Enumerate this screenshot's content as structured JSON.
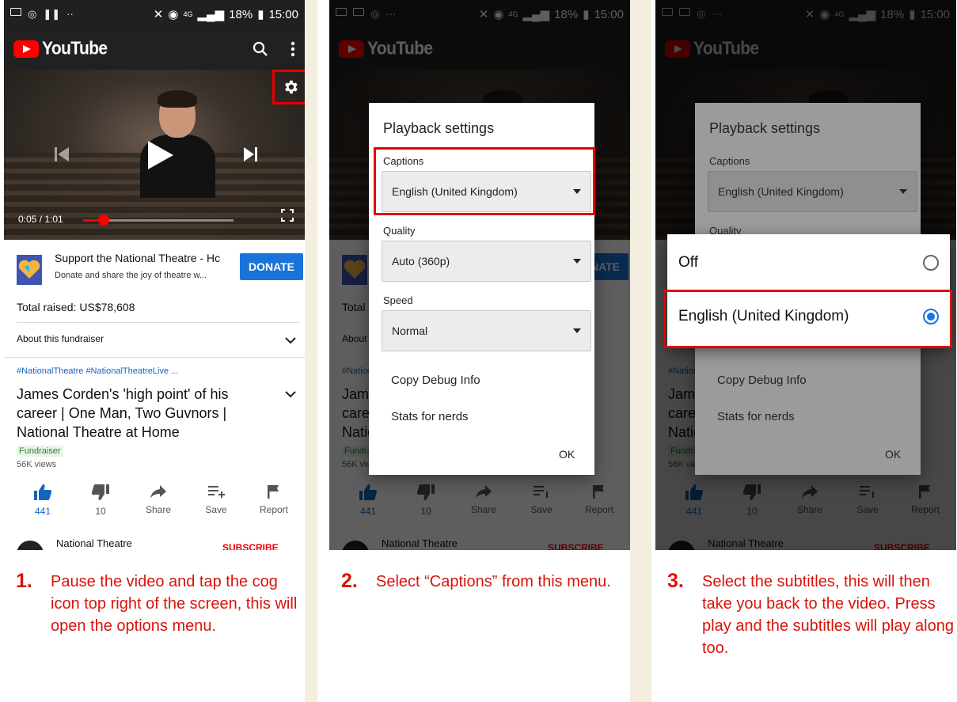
{
  "status_time": "15:00",
  "status_battery": "18%",
  "status_network": "4G",
  "brand": "YouTube",
  "video": {
    "time": "0:05 / 1:01",
    "progress": 0.08
  },
  "fundraiser": {
    "title": "Support the National Theatre - Hc",
    "subtitle": "Donate and share the joy of theatre w...",
    "donate_label": "DONATE",
    "total_raised": "Total raised: US$78,608",
    "about": "About this fundraiser"
  },
  "video_info": {
    "hashtags": "#NationalTheatre  #NationalTheatreLive ...",
    "title": "James Corden's 'high point' of his career | One Man, Two Guvnors | National Theatre at Home",
    "tag": "Fundraiser",
    "views": "56K views"
  },
  "actions": [
    {
      "label": "441",
      "icon": "thumbs-up-icon"
    },
    {
      "label": "10",
      "icon": "thumbs-down-icon"
    },
    {
      "label": "Share",
      "icon": "share-icon"
    },
    {
      "label": "Save",
      "icon": "save-icon"
    },
    {
      "label": "Report",
      "icon": "flag-icon"
    }
  ],
  "channel": {
    "name": "National Theatre",
    "subscribe": "SUBSCRIBE"
  },
  "dialog": {
    "title": "Playback settings",
    "captions_label": "Captions",
    "captions_value": "English (United Kingdom)",
    "quality_label": "Quality",
    "quality_value": "Auto (360p)",
    "speed_label": "Speed",
    "speed_value": "Normal",
    "copy_debug": "Copy Debug Info",
    "stats": "Stats for nerds",
    "ok": "OK"
  },
  "picker": {
    "options": [
      {
        "label": "Off",
        "selected": false
      },
      {
        "label": "English (United Kingdom)",
        "selected": true
      }
    ]
  },
  "steps": [
    {
      "num": "1.",
      "text": "Pause the video and tap the cog icon top right of the screen, this will open the options menu."
    },
    {
      "num": "2.",
      "text": "Select “Captions” from this menu."
    },
    {
      "num": "3.",
      "text": "Select the subtitles, this will then take you back to the video. Press play and the subtitles will play along too."
    }
  ],
  "colors": {
    "highlight": "#e30000",
    "step_text": "#d8140a",
    "youtube_red": "#ff0000",
    "donate_blue": "#1a73d9",
    "gutter": "#f3eedf"
  }
}
